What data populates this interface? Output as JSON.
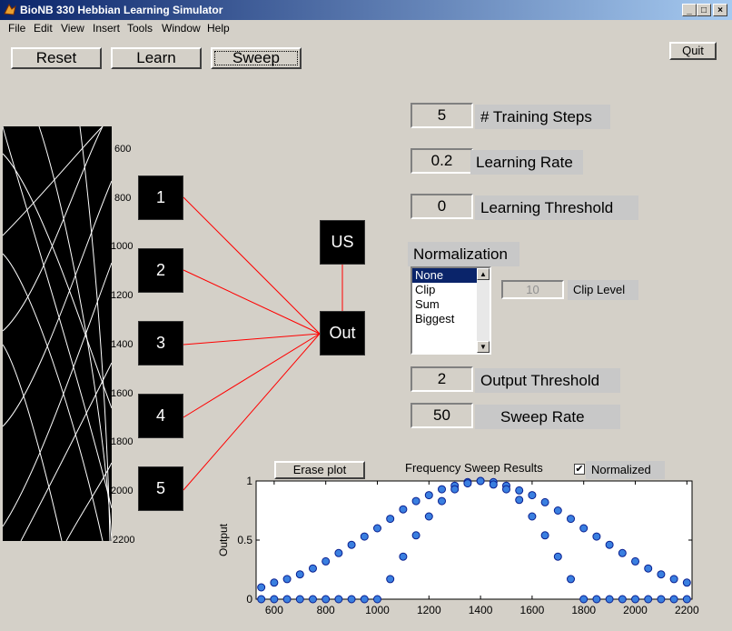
{
  "window": {
    "title": "BioNB 330 Hebbian Learning Simulator",
    "controls": [
      "_",
      "□",
      "×"
    ]
  },
  "menu": [
    "File",
    "Edit",
    "View",
    "Insert",
    "Tools",
    "Window",
    "Help"
  ],
  "top_buttons": {
    "reset": "Reset",
    "learn": "Learn",
    "sweep": "Sweep",
    "quit": "Quit"
  },
  "neurons": {
    "inputs": [
      "1",
      "2",
      "3",
      "4",
      "5"
    ],
    "us": "US",
    "out": "Out"
  },
  "stimulus_axis": {
    "ticks": [
      "600",
      "800",
      "1000",
      "1200",
      "1400",
      "1600",
      "1800",
      "2000",
      "2200"
    ]
  },
  "params": {
    "training_steps": {
      "value": "5",
      "label": "# Training Steps"
    },
    "learning_rate": {
      "value": "0.2",
      "label": "Learning Rate"
    },
    "learning_threshold": {
      "value": "0",
      "label": "Learning Threshold"
    },
    "normalization_label": "Normalization",
    "normalization_options": [
      "None",
      "Clip",
      "Sum",
      "Biggest"
    ],
    "normalization_selected": "None",
    "clip_level": {
      "value": "10",
      "label": "Clip Level"
    },
    "output_threshold": {
      "value": "2",
      "label": "Output Threshold"
    },
    "sweep_rate": {
      "value": "50",
      "label": "Sweep Rate"
    }
  },
  "plot_controls": {
    "erase": "Erase plot",
    "title": "Frequency Sweep Results",
    "normalized_label": "Normalized",
    "normalized_checked": true,
    "check_glyph": "✔"
  },
  "chart_data": {
    "type": "scatter",
    "title": "Frequency Sweep Results",
    "xlabel": "",
    "ylabel": "Output",
    "xlim": [
      530,
      2220
    ],
    "ylim": [
      0,
      1
    ],
    "xticks": [
      600,
      800,
      1000,
      1200,
      1400,
      1600,
      1800,
      2000,
      2200
    ],
    "yticks": [
      0,
      0.5,
      1
    ],
    "x": [
      550,
      600,
      650,
      700,
      750,
      800,
      850,
      900,
      950,
      1000,
      1050,
      1100,
      1150,
      1200,
      1250,
      1300,
      1350,
      1400,
      1450,
      1500,
      1550,
      1600,
      1650,
      1700,
      1750,
      1800,
      1850,
      1900,
      1950,
      2000,
      2050,
      2100,
      2150,
      2200
    ],
    "series": [
      {
        "values": [
          0.1,
          0.14,
          0.17,
          0.21,
          0.26,
          0.32,
          0.39,
          0.46,
          0.53,
          0.6,
          0.68,
          0.76,
          0.83,
          0.88,
          0.93,
          0.96,
          0.99,
          1.0,
          0.99,
          0.96,
          0.92,
          0.88,
          0.82,
          0.75,
          0.68,
          0.6,
          0.53,
          0.46,
          0.39,
          0.32,
          0.26,
          0.21,
          0.17,
          0.14
        ]
      },
      {
        "values": [
          0,
          0,
          0,
          0,
          0,
          0,
          0,
          0,
          0,
          0,
          0.17,
          0.36,
          0.54,
          0.7,
          0.83,
          0.93,
          0.98,
          1.0,
          0.97,
          0.93,
          0.84,
          0.7,
          0.54,
          0.36,
          0.17,
          0,
          0,
          0,
          0,
          0,
          0,
          0,
          0,
          0
        ]
      }
    ],
    "colors": {
      "marker_fill": "#3a7fe0",
      "marker_edge": "#0a1f8f"
    }
  },
  "colors": {
    "connection": "#ff0000",
    "neuron_bg": "#000000",
    "title_start": "#0a246a",
    "title_end": "#a6caf0",
    "selection": "#0a246a"
  }
}
